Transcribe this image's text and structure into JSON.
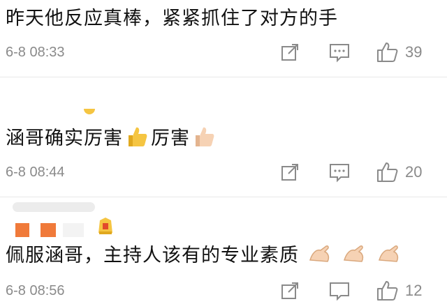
{
  "comments": [
    {
      "text": "昨天他反应真棒，紧紧抓住了对方的手",
      "time": "6-8 08:33",
      "likes": "39"
    },
    {
      "text_a": "涵哥确实厉害",
      "text_b": "厉害",
      "time": "6-8 08:44",
      "likes": "20"
    },
    {
      "text": "佩服涵哥，主持人该有的专业素质",
      "time": "6-8 08:56",
      "likes": "12"
    }
  ],
  "icons": {
    "share": "share-icon",
    "reply": "comment-icon",
    "like": "thumbs-up-icon"
  },
  "colors": {
    "meta_gray": "#8a8a8a",
    "avatar_orange": "#f07a3a",
    "emoji_yellow": "#f5c542"
  }
}
